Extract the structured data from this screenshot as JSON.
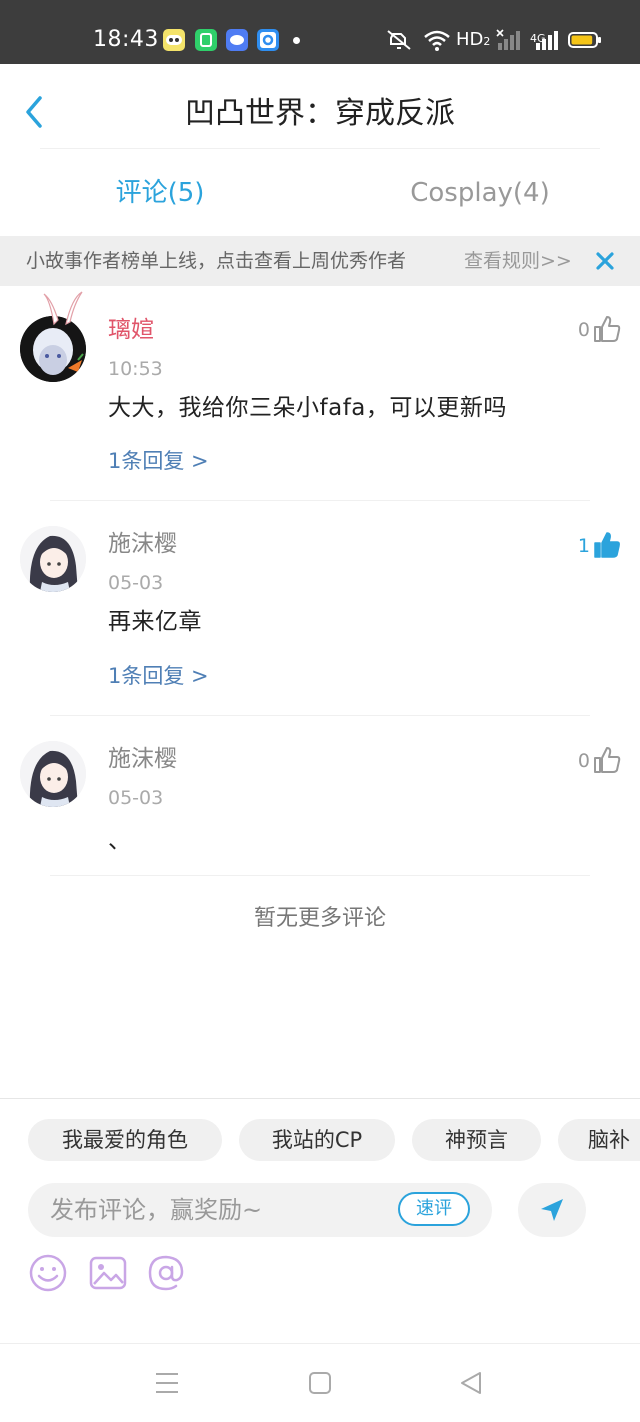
{
  "status_bar": {
    "time": "18:43",
    "network_label": "HD",
    "network_sub": "2",
    "cell_label": "4G",
    "icons": [
      "app-notification-icon",
      "app-notification-icon",
      "app-notification-icon",
      "app-notification-icon",
      "mute-icon",
      "wifi-icon",
      "signal-icon",
      "battery-icon"
    ],
    "battery_level": 0.9
  },
  "header": {
    "title": "凹凸世界：穿成反派"
  },
  "tabs": [
    {
      "label": "评论(5)",
      "active": true
    },
    {
      "label": "Cosplay(4)",
      "active": false
    }
  ],
  "notice": {
    "text": "小故事作者榜单上线，点击查看上周优秀作者",
    "link": "查看规则>>"
  },
  "comments": [
    {
      "name": "璃媗",
      "name_color": "#e0556a",
      "time": "10:53",
      "body": "大大，我给你三朵小fafa，可以更新吗",
      "reply": "1条回复 >",
      "likes": "0",
      "liked": false
    },
    {
      "name": "施沫樱",
      "name_color": "#888888",
      "time": "05-03",
      "body": "再来亿章",
      "reply": "1条回复 >",
      "likes": "1",
      "liked": true
    },
    {
      "name": "施沫樱",
      "name_color": "#888888",
      "time": "05-03",
      "body": "、",
      "reply": "",
      "likes": "0",
      "liked": false
    }
  ],
  "no_more": "暂无更多评论",
  "compose": {
    "chips": [
      "我最爱的角色",
      "我站的CP",
      "神预言",
      "脑补"
    ],
    "placeholder": "发布评论，赢奖励~",
    "quick_label": "速评",
    "tools": [
      "emoji-icon",
      "image-icon",
      "mention-icon"
    ]
  },
  "colors": {
    "accent": "#2ba3dc",
    "tool_purple": "#c9a6e6",
    "reply_link": "#4f7fb5"
  }
}
